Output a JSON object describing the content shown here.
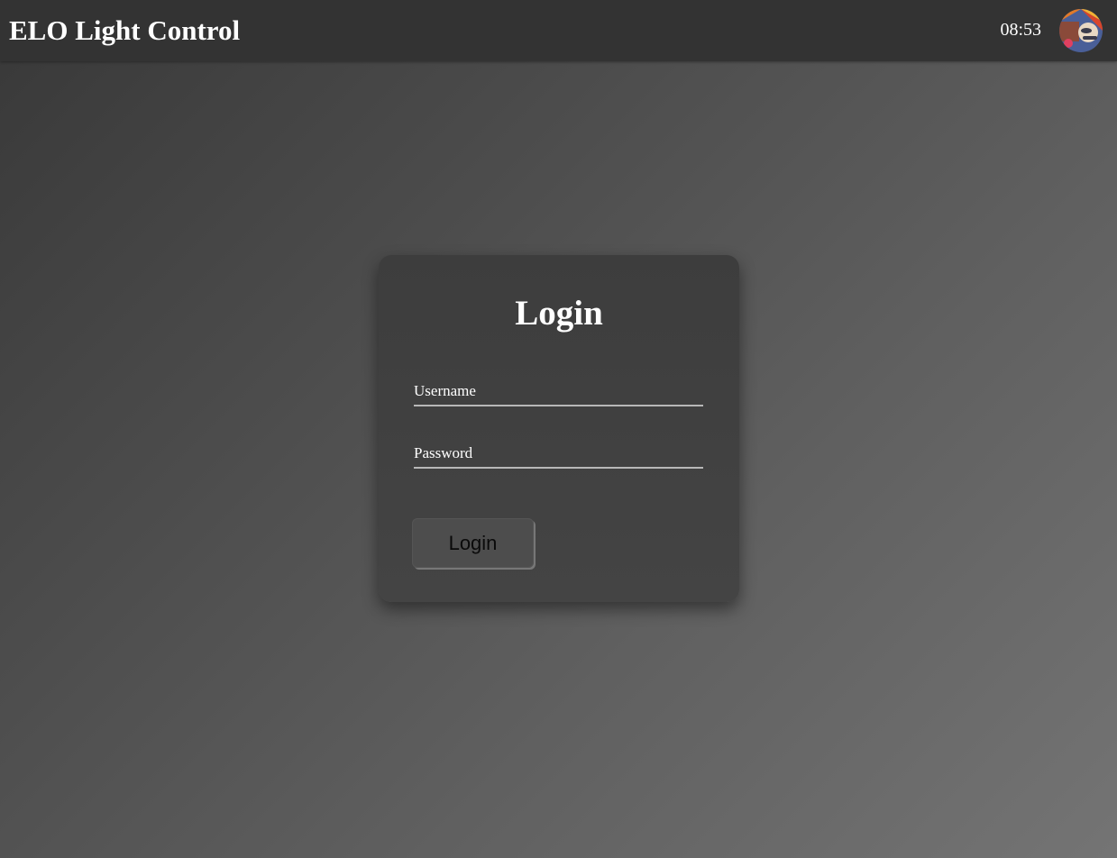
{
  "header": {
    "title": "ELO Light Control",
    "time": "08:53",
    "avatar_icon": "user-avatar-icon"
  },
  "login": {
    "title": "Login",
    "username_placeholder": "Username",
    "password_placeholder": "Password",
    "button_label": "Login"
  },
  "colors": {
    "topbar": "#333333",
    "card": "#414141",
    "text": "#ffffff",
    "field_underline": "#b8b8b8"
  }
}
